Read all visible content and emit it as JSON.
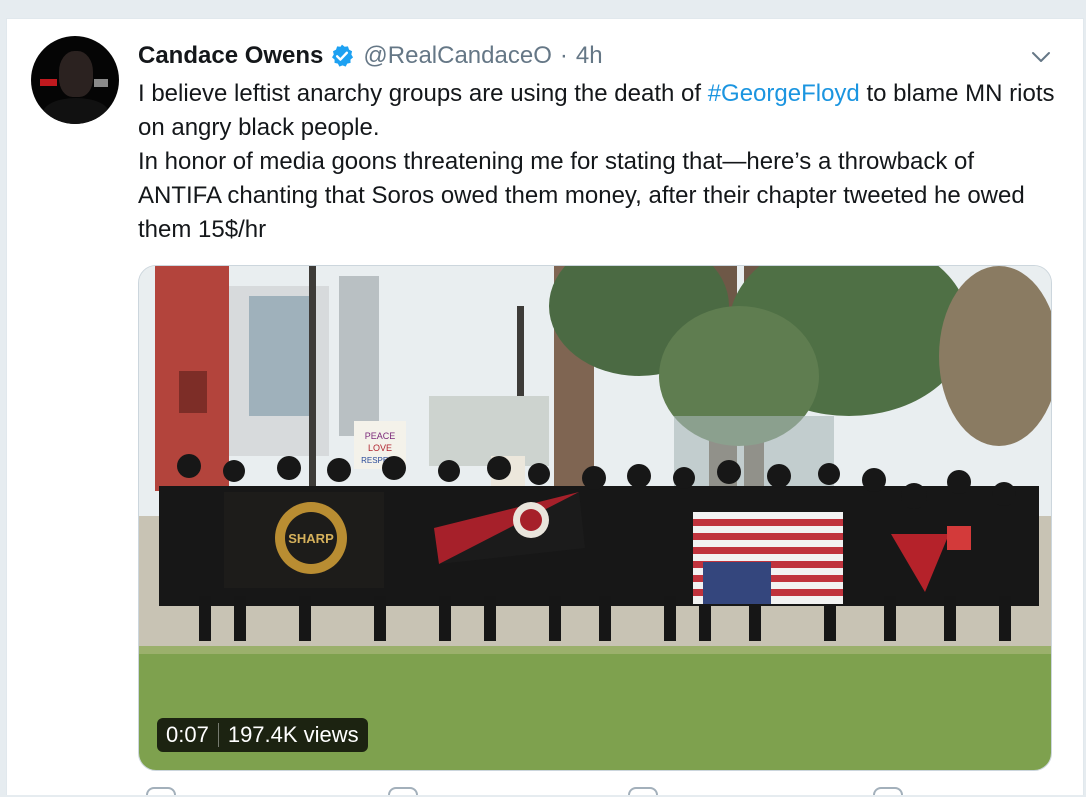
{
  "tweet": {
    "author_name": "Candace Owens",
    "handle": "@RealCandaceO",
    "separator": "·",
    "timestamp": "4h",
    "text_line1_before": "I believe leftist anarchy groups are using the death of ",
    "hashtag": "#GeorgeFloyd",
    "text_line1_after": " to blame MN riots on angry black people.",
    "text_paragraph2": "In honor of media goons threatening me for stating that—here’s a throwback of ANTIFA chanting that Soros owed them money, after their chapter tweeted he owed them 15$/hr"
  },
  "media": {
    "duration": "0:07",
    "views": "197.4K views",
    "sign_text": [
      "PEACE",
      "LOVE",
      "RESPECT"
    ],
    "flag_text": "SHARP"
  },
  "colors": {
    "link": "#1b95e0",
    "verified": "#1da1f2",
    "muted": "#657786"
  },
  "icons": {
    "verified": "verified-badge-icon",
    "caret": "chevron-down-icon"
  }
}
